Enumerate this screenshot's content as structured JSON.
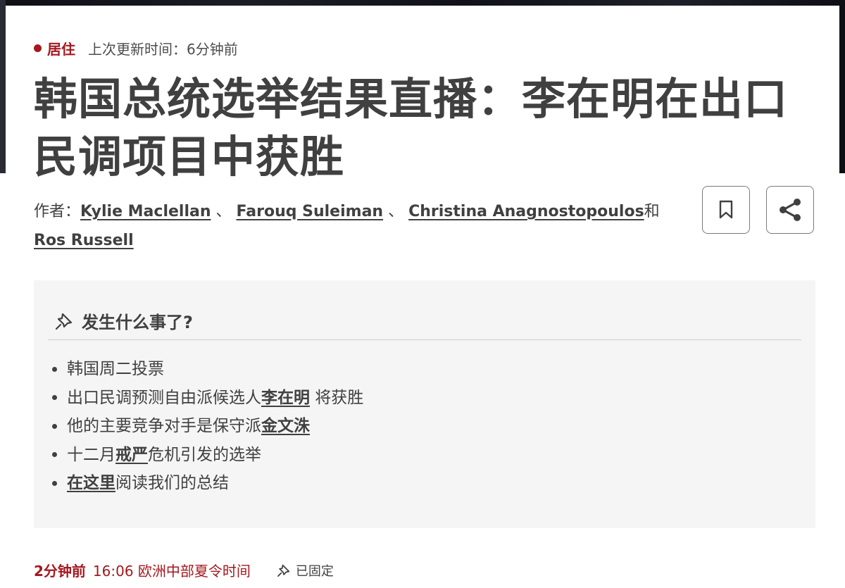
{
  "header": {
    "live_label": "居住",
    "updated_text": "上次更新时间：6分钟前"
  },
  "article": {
    "title": "韩国总统选举结果直播：李在明在出口民调项目中获胜",
    "byline_prefix": "作者：",
    "authors": [
      "Kylie Maclellan",
      "Farouq Suleiman",
      "Christina Anagnostopoulos",
      "Ros Russell"
    ],
    "separator": "、",
    "and_word": "和"
  },
  "actions": {
    "bookmark_icon": "bookmark-icon",
    "share_icon": "share-icon"
  },
  "summary": {
    "icon": "pin-icon",
    "title": "发生什么事了?",
    "items": [
      {
        "pre": "韩国周二投票",
        "link": "",
        "post": ""
      },
      {
        "pre": "出口民调预测自由派候选人",
        "link": "李在明",
        "post": " 将获胜"
      },
      {
        "pre": "他的主要竞争对手是保守派",
        "link": "金文洙",
        "post": ""
      },
      {
        "pre": "十二月",
        "link": "戒严",
        "post": "危机引发的选举"
      },
      {
        "pre": "",
        "link": "在这里",
        "post": "阅读我们的总结"
      }
    ]
  },
  "post": {
    "ago": "2分钟前",
    "timestamp": "16:06 欧洲中部夏令时间",
    "pinned_label": "已固定",
    "pinned_icon": "pin-icon"
  },
  "colors": {
    "accent": "#a3191f",
    "text": "#404040",
    "summary_bg": "#f5f5f5"
  }
}
